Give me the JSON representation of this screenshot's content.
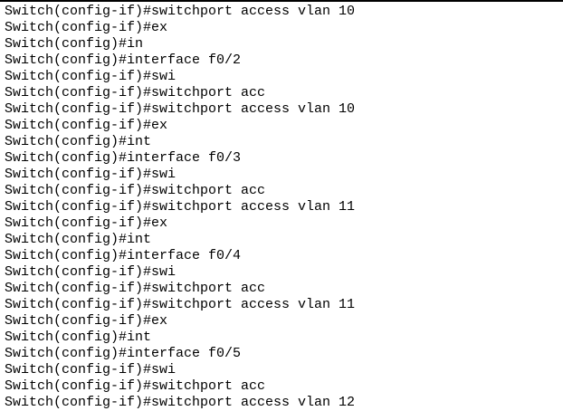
{
  "terminal": {
    "lines": [
      "Switch(config-if)#switchport access vlan 10",
      "Switch(config-if)#ex",
      "Switch(config)#in",
      "Switch(config)#interface f0/2",
      "Switch(config-if)#swi",
      "Switch(config-if)#switchport acc",
      "Switch(config-if)#switchport access vlan 10",
      "Switch(config-if)#ex",
      "Switch(config)#int",
      "Switch(config)#interface f0/3",
      "Switch(config-if)#swi",
      "Switch(config-if)#switchport acc",
      "Switch(config-if)#switchport access vlan 11",
      "Switch(config-if)#ex",
      "Switch(config)#int",
      "Switch(config)#interface f0/4",
      "Switch(config-if)#swi",
      "Switch(config-if)#switchport acc",
      "Switch(config-if)#switchport access vlan 11",
      "Switch(config-if)#ex",
      "Switch(config)#int",
      "Switch(config)#interface f0/5",
      "Switch(config-if)#swi",
      "Switch(config-if)#switchport acc",
      "Switch(config-if)#switchport access vlan 12"
    ]
  }
}
